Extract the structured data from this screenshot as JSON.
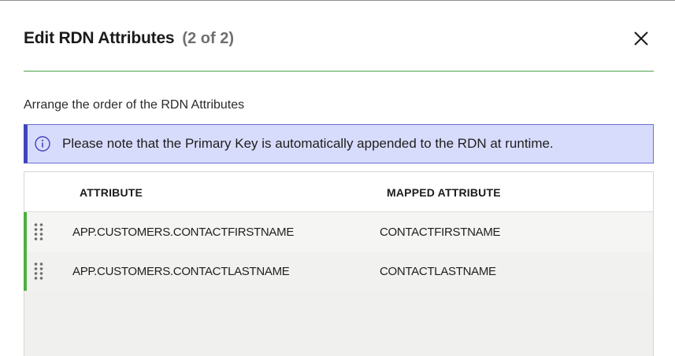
{
  "dialog": {
    "title": "Edit RDN Attributes",
    "step": "(2 of 2)",
    "close_icon": "close-icon"
  },
  "instructions": "Arrange the order of the RDN Attributes",
  "info_banner": {
    "icon": "info-icon",
    "text": "Please note that the Primary Key is automatically appended to the RDN at runtime."
  },
  "table": {
    "columns": [
      "ATTRIBUTE",
      "MAPPED ATTRIBUTE"
    ],
    "rows": [
      {
        "attribute": "APP.CUSTOMERS.CONTACTFIRSTNAME",
        "mapped": "CONTACTFIRSTNAME"
      },
      {
        "attribute": "APP.CUSTOMERS.CONTACTLASTNAME",
        "mapped": "CONTACTLASTNAME"
      }
    ]
  },
  "colors": {
    "divider": "#4ca24a",
    "banner_bg": "#d8dcfc",
    "banner_accent": "#3f45bd",
    "row_accent": "#4bb03e"
  }
}
